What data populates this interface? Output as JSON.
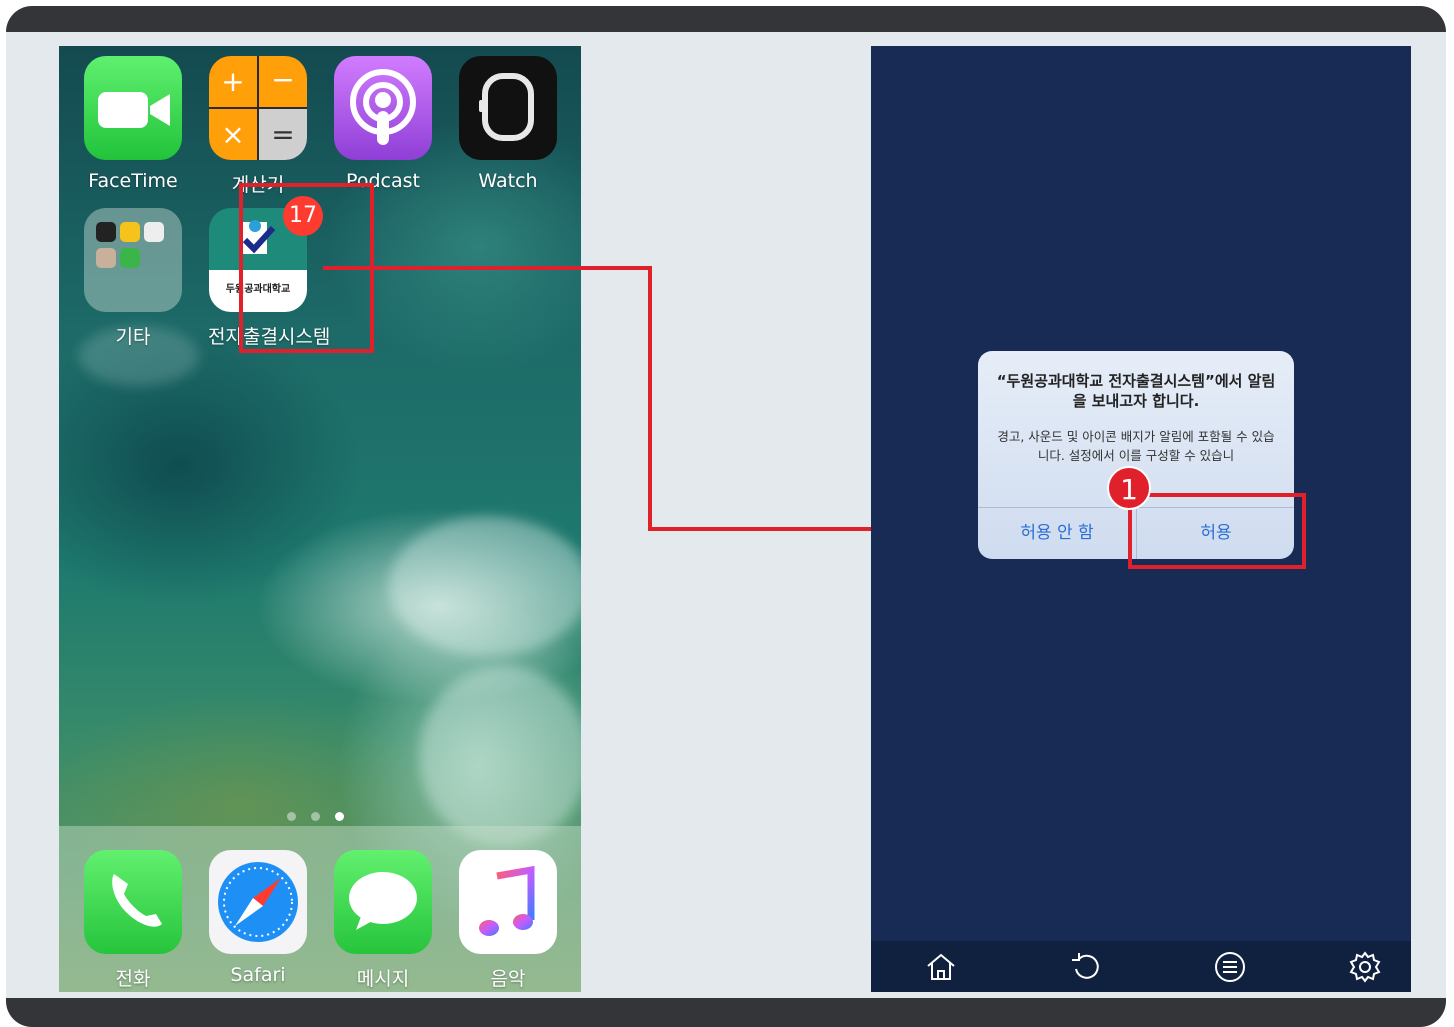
{
  "home": {
    "apps": [
      {
        "label": "FaceTime",
        "icon": "facetime-icon"
      },
      {
        "label": "계산기",
        "icon": "calculator-icon"
      },
      {
        "label": "Podcast",
        "icon": "podcast-icon"
      },
      {
        "label": "Watch",
        "icon": "watch-icon"
      },
      {
        "label": "기타",
        "icon": "folder-icon"
      },
      {
        "label": "전자출결시스템",
        "icon": "attendance-app-icon",
        "badge": "17",
        "tile_text": "두원공과대학교"
      }
    ],
    "dock": [
      {
        "label": "전화",
        "icon": "phone-icon"
      },
      {
        "label": "Safari",
        "icon": "safari-icon"
      },
      {
        "label": "메시지",
        "icon": "messages-icon"
      },
      {
        "label": "음악",
        "icon": "music-icon"
      }
    ],
    "page_dots": {
      "count": 3,
      "active": 3
    }
  },
  "dialog": {
    "title": "“두원공과대학교 전자출결시스템”에서 알림을 보내고자 합니다.",
    "message": "경고, 사운드 및 아이콘 배지가 알림에 포함될 수 있습니다. 설정에서 이를 구성할 수 있습니",
    "deny_label": "허용 안 함",
    "allow_label": "허용"
  },
  "step_number": "1",
  "bottom_bar": [
    "home-icon",
    "refresh-icon",
    "menu-icon",
    "settings-icon"
  ],
  "colors": {
    "highlight": "#e0212b",
    "badge": "#ff3b30",
    "dialog_button": "#2b6fd6",
    "right_bg": "#172b55"
  }
}
